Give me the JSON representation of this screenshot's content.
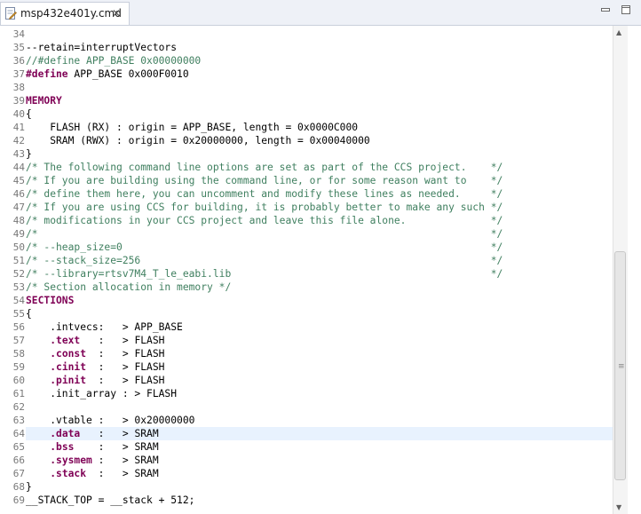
{
  "tab": {
    "title": "msp432e401y.cmd",
    "close_glyph": "✕"
  },
  "editor": {
    "highlight_line": "64",
    "lines": [
      {
        "n": "34",
        "html": ""
      },
      {
        "n": "35",
        "html": "--retain=interruptVectors"
      },
      {
        "n": "36",
        "html": "<span class=\"cm\">//#define APP_BASE 0x00000000</span>"
      },
      {
        "n": "37",
        "html": "<span class=\"kw\">#define</span> APP_BASE 0x000F0010"
      },
      {
        "n": "38",
        "html": ""
      },
      {
        "n": "39",
        "html": "<span class=\"kw\">MEMORY</span>"
      },
      {
        "n": "40",
        "html": "{"
      },
      {
        "n": "41",
        "html": "    FLASH (RX) : origin = APP_BASE, length = 0x0000C000"
      },
      {
        "n": "42",
        "html": "    SRAM (RWX) : origin = 0x20000000, length = 0x00040000"
      },
      {
        "n": "43",
        "html": "}"
      },
      {
        "n": "44",
        "html": "<span class=\"cm\">/* The following command line options are set as part of the CCS project.    */</span>"
      },
      {
        "n": "45",
        "html": "<span class=\"cm\">/* If you are building using the command line, or for some reason want to    */</span>"
      },
      {
        "n": "46",
        "html": "<span class=\"cm\">/* define them here, you can uncomment and modify these lines as needed.     */</span>"
      },
      {
        "n": "47",
        "html": "<span class=\"cm\">/* If you are using CCS for building, it is probably better to make any such */</span>"
      },
      {
        "n": "48",
        "html": "<span class=\"cm\">/* modifications in your CCS project and leave this file alone.              */</span>"
      },
      {
        "n": "49",
        "html": "<span class=\"cm\">/*                                                                           */</span>"
      },
      {
        "n": "50",
        "html": "<span class=\"cm\">/* --heap_size=0                                                             */</span>"
      },
      {
        "n": "51",
        "html": "<span class=\"cm\">/* --stack_size=256                                                          */</span>"
      },
      {
        "n": "52",
        "html": "<span class=\"cm\">/* --library=rtsv7M4_T_le_eabi.lib                                           */</span>"
      },
      {
        "n": "53",
        "html": "<span class=\"cm\">/* Section allocation in memory */</span>"
      },
      {
        "n": "54",
        "html": "<span class=\"kw\">SECTIONS</span>"
      },
      {
        "n": "55",
        "html": "{"
      },
      {
        "n": "56",
        "html": "    .intvecs:   > APP_BASE"
      },
      {
        "n": "57",
        "html": "    <span class=\"kw\">.text</span>   :   > FLASH"
      },
      {
        "n": "58",
        "html": "    <span class=\"kw\">.const</span>  :   > FLASH"
      },
      {
        "n": "59",
        "html": "    <span class=\"kw\">.cinit</span>  :   > FLASH"
      },
      {
        "n": "60",
        "html": "    <span class=\"kw\">.pinit</span>  :   > FLASH"
      },
      {
        "n": "61",
        "html": "    .init_array : > FLASH"
      },
      {
        "n": "62",
        "html": ""
      },
      {
        "n": "63",
        "html": "    .vtable :   > 0x20000000"
      },
      {
        "n": "64",
        "html": "    <span class=\"kw\">.data</span>   :   > SRAM"
      },
      {
        "n": "65",
        "html": "    <span class=\"kw\">.bss</span>    :   > SRAM"
      },
      {
        "n": "66",
        "html": "    <span class=\"kw\">.sysmem</span> :   > SRAM"
      },
      {
        "n": "67",
        "html": "    <span class=\"kw\">.stack</span>  :   > SRAM"
      },
      {
        "n": "68",
        "html": "}"
      },
      {
        "n": "69",
        "html": "__STACK_TOP = __stack + 512;"
      }
    ]
  }
}
